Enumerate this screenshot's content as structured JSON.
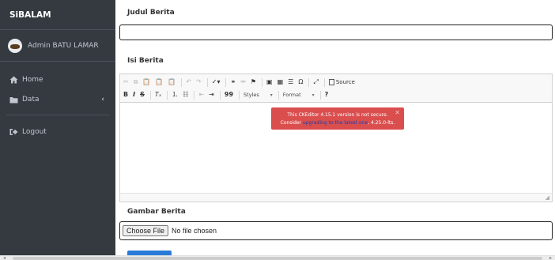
{
  "sidebar": {
    "brand": "SiBALAM",
    "user": "Admin BATU LAMAR",
    "nav": [
      {
        "label": "Home",
        "icon": "home-icon"
      },
      {
        "label": "Data",
        "icon": "folder-icon"
      },
      {
        "label": "Logout",
        "icon": "sign-out-icon"
      }
    ]
  },
  "form": {
    "title_label": "Judul Berita",
    "body_label": "Isi Berita",
    "image_label": "Gambar Berita",
    "file_button": "Choose File",
    "file_status": "No file chosen"
  },
  "editor": {
    "styles_combo": "Styles",
    "format_combo": "Format",
    "source_label": "Source",
    "notice": {
      "line1": "This CKEditor 4.15.1 version is not secure.",
      "pre": "Consider",
      "link": "upgrading to the latest one",
      "post": ", 4.25.0-lts."
    }
  },
  "colors": {
    "sidebar_bg": "#343a40",
    "notice_bg": "#db4e4e",
    "primary": "#2a7bd8"
  }
}
